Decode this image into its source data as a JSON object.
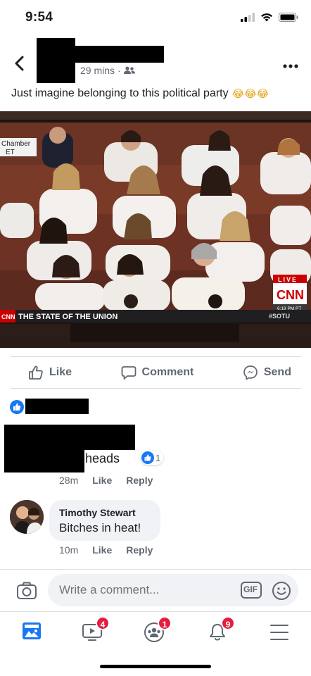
{
  "status": {
    "time": "9:54"
  },
  "post": {
    "timestamp": "29 mins",
    "dot": "·",
    "text": "Just imagine belonging to this political party",
    "emoji": "😂😂😂"
  },
  "tv": {
    "chamber_text": "Chamber",
    "et_text": "ET",
    "ticker": "THE STATE OF THE UNION",
    "network": "CNN",
    "live": "LIVE",
    "clock": "6:19 PM PT",
    "hashtag": "#SOTU"
  },
  "actions": {
    "like": "Like",
    "comment": "Comment",
    "send": "Send"
  },
  "comments": [
    {
      "partial_text": "heads",
      "reaction_count": "1",
      "time": "28m",
      "like": "Like",
      "reply": "Reply"
    },
    {
      "author": "Timothy Stewart",
      "text": "Bitches in heat!",
      "time": "10m",
      "like": "Like",
      "reply": "Reply"
    }
  ],
  "composer": {
    "placeholder": "Write a comment...",
    "gif": "GIF"
  },
  "nav": {
    "watch_badge": "4",
    "groups_badge": "1",
    "notifications_badge": "9"
  },
  "colors": {
    "facebook_blue": "#1877f2",
    "badge_red": "#e41e3f",
    "cnn_red": "#cc0000"
  },
  "icons": {
    "back": "chevron-left-icon",
    "more": "more-dots-icon",
    "audience": "friends-icon",
    "like": "thumbs-up-icon",
    "comment": "speech-bubble-icon",
    "send": "messenger-icon",
    "camera": "camera-icon",
    "gif": "gif-icon",
    "emoji": "smiley-icon",
    "feed": "news-feed-icon",
    "watch": "watch-video-icon",
    "groups": "groups-icon",
    "notifications": "bell-icon",
    "menu": "hamburger-menu-icon"
  }
}
